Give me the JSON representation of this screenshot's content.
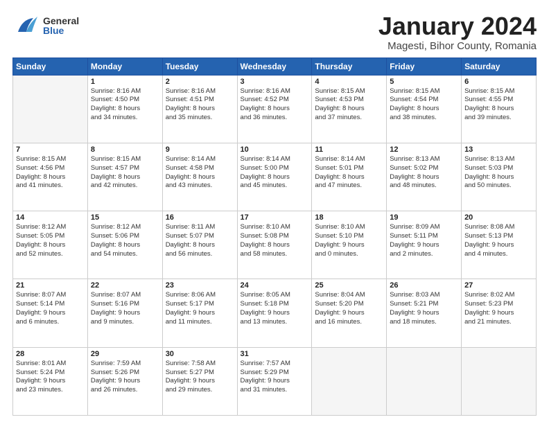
{
  "header": {
    "logo_general": "General",
    "logo_blue": "Blue",
    "month_title": "January 2024",
    "location": "Magesti, Bihor County, Romania"
  },
  "weekdays": [
    "Sunday",
    "Monday",
    "Tuesday",
    "Wednesday",
    "Thursday",
    "Friday",
    "Saturday"
  ],
  "weeks": [
    [
      {
        "day": "",
        "info": ""
      },
      {
        "day": "1",
        "info": "Sunrise: 8:16 AM\nSunset: 4:50 PM\nDaylight: 8 hours\nand 34 minutes."
      },
      {
        "day": "2",
        "info": "Sunrise: 8:16 AM\nSunset: 4:51 PM\nDaylight: 8 hours\nand 35 minutes."
      },
      {
        "day": "3",
        "info": "Sunrise: 8:16 AM\nSunset: 4:52 PM\nDaylight: 8 hours\nand 36 minutes."
      },
      {
        "day": "4",
        "info": "Sunrise: 8:15 AM\nSunset: 4:53 PM\nDaylight: 8 hours\nand 37 minutes."
      },
      {
        "day": "5",
        "info": "Sunrise: 8:15 AM\nSunset: 4:54 PM\nDaylight: 8 hours\nand 38 minutes."
      },
      {
        "day": "6",
        "info": "Sunrise: 8:15 AM\nSunset: 4:55 PM\nDaylight: 8 hours\nand 39 minutes."
      }
    ],
    [
      {
        "day": "7",
        "info": "Sunrise: 8:15 AM\nSunset: 4:56 PM\nDaylight: 8 hours\nand 41 minutes."
      },
      {
        "day": "8",
        "info": "Sunrise: 8:15 AM\nSunset: 4:57 PM\nDaylight: 8 hours\nand 42 minutes."
      },
      {
        "day": "9",
        "info": "Sunrise: 8:14 AM\nSunset: 4:58 PM\nDaylight: 8 hours\nand 43 minutes."
      },
      {
        "day": "10",
        "info": "Sunrise: 8:14 AM\nSunset: 5:00 PM\nDaylight: 8 hours\nand 45 minutes."
      },
      {
        "day": "11",
        "info": "Sunrise: 8:14 AM\nSunset: 5:01 PM\nDaylight: 8 hours\nand 47 minutes."
      },
      {
        "day": "12",
        "info": "Sunrise: 8:13 AM\nSunset: 5:02 PM\nDaylight: 8 hours\nand 48 minutes."
      },
      {
        "day": "13",
        "info": "Sunrise: 8:13 AM\nSunset: 5:03 PM\nDaylight: 8 hours\nand 50 minutes."
      }
    ],
    [
      {
        "day": "14",
        "info": "Sunrise: 8:12 AM\nSunset: 5:05 PM\nDaylight: 8 hours\nand 52 minutes."
      },
      {
        "day": "15",
        "info": "Sunrise: 8:12 AM\nSunset: 5:06 PM\nDaylight: 8 hours\nand 54 minutes."
      },
      {
        "day": "16",
        "info": "Sunrise: 8:11 AM\nSunset: 5:07 PM\nDaylight: 8 hours\nand 56 minutes."
      },
      {
        "day": "17",
        "info": "Sunrise: 8:10 AM\nSunset: 5:08 PM\nDaylight: 8 hours\nand 58 minutes."
      },
      {
        "day": "18",
        "info": "Sunrise: 8:10 AM\nSunset: 5:10 PM\nDaylight: 9 hours\nand 0 minutes."
      },
      {
        "day": "19",
        "info": "Sunrise: 8:09 AM\nSunset: 5:11 PM\nDaylight: 9 hours\nand 2 minutes."
      },
      {
        "day": "20",
        "info": "Sunrise: 8:08 AM\nSunset: 5:13 PM\nDaylight: 9 hours\nand 4 minutes."
      }
    ],
    [
      {
        "day": "21",
        "info": "Sunrise: 8:07 AM\nSunset: 5:14 PM\nDaylight: 9 hours\nand 6 minutes."
      },
      {
        "day": "22",
        "info": "Sunrise: 8:07 AM\nSunset: 5:16 PM\nDaylight: 9 hours\nand 9 minutes."
      },
      {
        "day": "23",
        "info": "Sunrise: 8:06 AM\nSunset: 5:17 PM\nDaylight: 9 hours\nand 11 minutes."
      },
      {
        "day": "24",
        "info": "Sunrise: 8:05 AM\nSunset: 5:18 PM\nDaylight: 9 hours\nand 13 minutes."
      },
      {
        "day": "25",
        "info": "Sunrise: 8:04 AM\nSunset: 5:20 PM\nDaylight: 9 hours\nand 16 minutes."
      },
      {
        "day": "26",
        "info": "Sunrise: 8:03 AM\nSunset: 5:21 PM\nDaylight: 9 hours\nand 18 minutes."
      },
      {
        "day": "27",
        "info": "Sunrise: 8:02 AM\nSunset: 5:23 PM\nDaylight: 9 hours\nand 21 minutes."
      }
    ],
    [
      {
        "day": "28",
        "info": "Sunrise: 8:01 AM\nSunset: 5:24 PM\nDaylight: 9 hours\nand 23 minutes."
      },
      {
        "day": "29",
        "info": "Sunrise: 7:59 AM\nSunset: 5:26 PM\nDaylight: 9 hours\nand 26 minutes."
      },
      {
        "day": "30",
        "info": "Sunrise: 7:58 AM\nSunset: 5:27 PM\nDaylight: 9 hours\nand 29 minutes."
      },
      {
        "day": "31",
        "info": "Sunrise: 7:57 AM\nSunset: 5:29 PM\nDaylight: 9 hours\nand 31 minutes."
      },
      {
        "day": "",
        "info": ""
      },
      {
        "day": "",
        "info": ""
      },
      {
        "day": "",
        "info": ""
      }
    ]
  ]
}
